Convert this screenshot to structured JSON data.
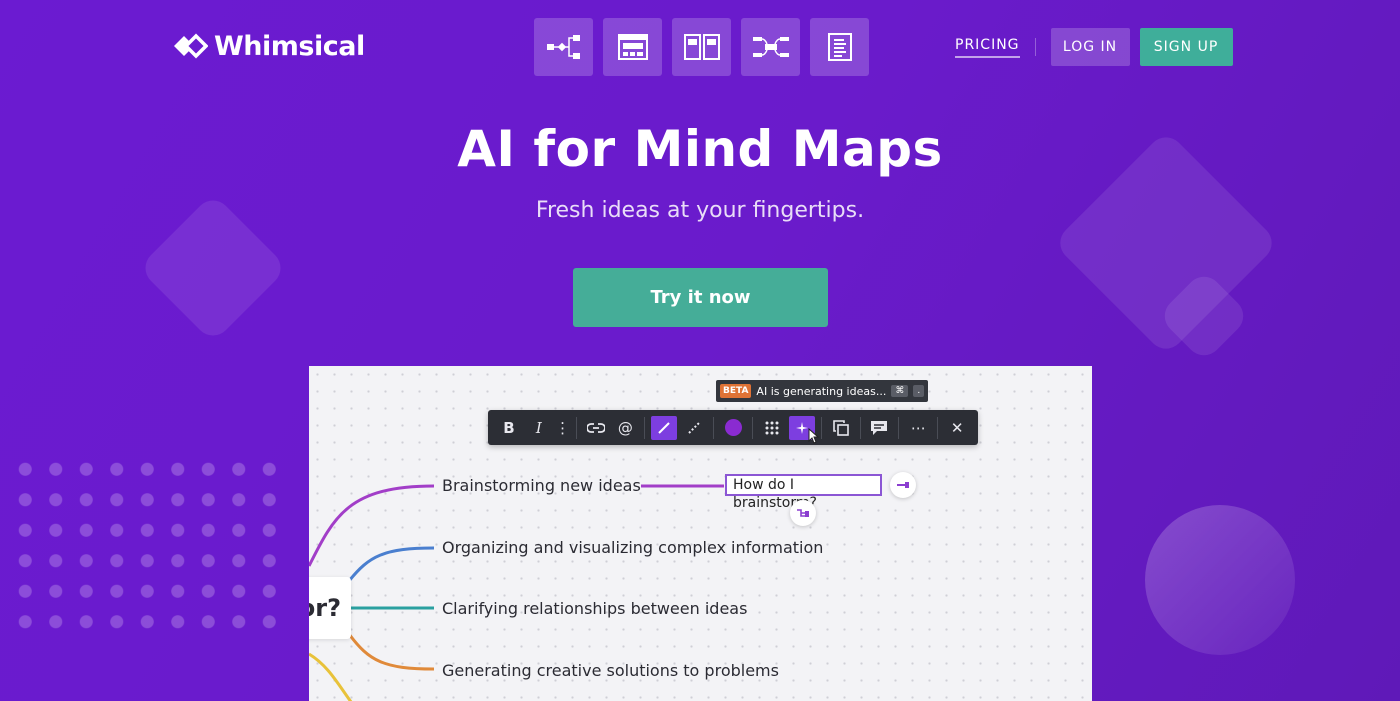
{
  "brand": {
    "name": "Whimsical"
  },
  "header": {
    "product_icons": [
      "flowchart-icon",
      "wireframe-icon",
      "board-icon",
      "mindmap-icon",
      "doc-icon"
    ],
    "pricing_label": "PRICING",
    "login_label": "LOG IN",
    "signup_label": "SIGN UP"
  },
  "hero": {
    "title": "AI for Mind Maps",
    "subtitle": "Fresh ideas at your fingertips.",
    "cta_label": "Try it now"
  },
  "canvas": {
    "root_text": "or?",
    "ideas": [
      "Brainstorming new ideas",
      "Organizing and visualizing complex information",
      "Clarifying relationships between ideas",
      "Generating creative solutions to problems"
    ],
    "input_value": "How do I brainstorm?",
    "ai_tooltip": {
      "badge": "BETA",
      "text": "AI is generating ideas...",
      "kbd": "⌘",
      "kbd2": "."
    },
    "toolbar": {
      "bold": "B",
      "italic": "I",
      "mention": "@",
      "more": "⋯",
      "close": "✕"
    }
  },
  "colors": {
    "background": "#6a1bcb",
    "accent_teal": "#45ad98",
    "branch_purple": "#a23ec8",
    "branch_blue": "#4a7fcf",
    "branch_teal": "#2aa0a0",
    "branch_orange": "#e08a3a",
    "branch_yellow": "#e8c23a"
  }
}
